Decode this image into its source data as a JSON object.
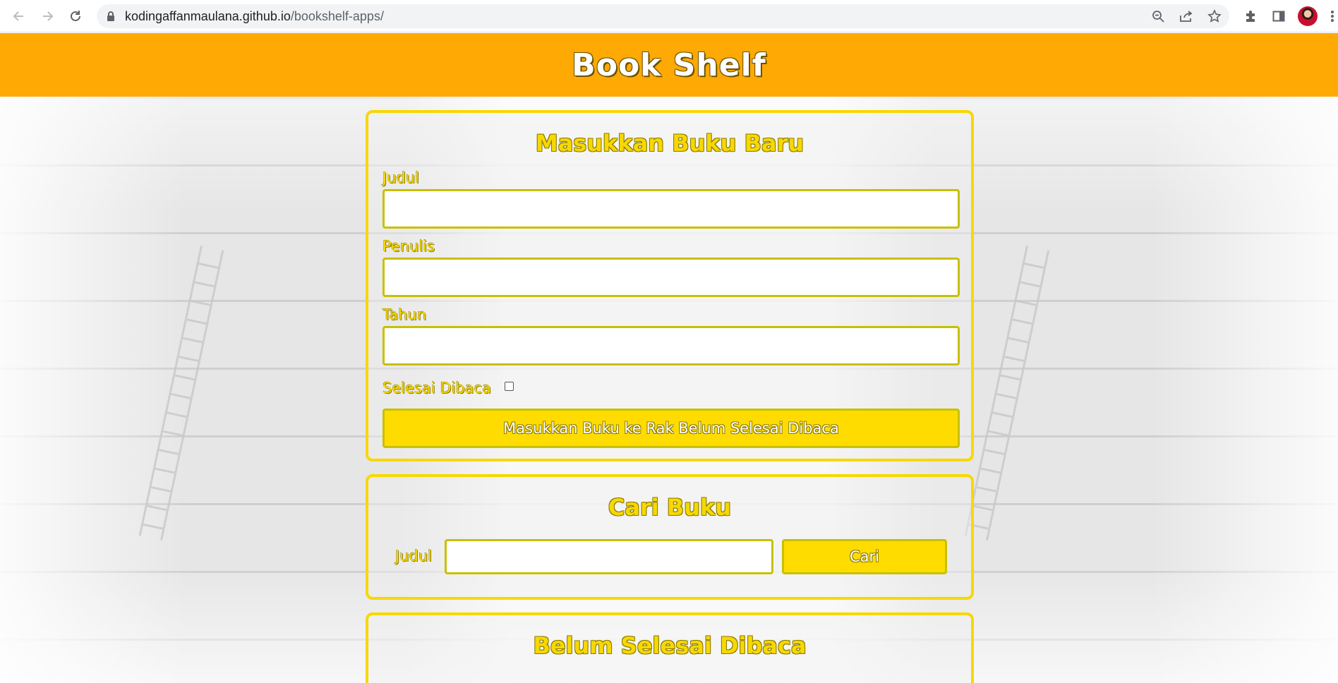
{
  "browser": {
    "url_host": "kodingaffanmaulana.github.io",
    "url_path": "/bookshelf-apps/",
    "icons": [
      "back-icon",
      "forward-icon",
      "reload-icon",
      "lock-icon",
      "zoom-icon",
      "share-icon",
      "bookmark-star-icon",
      "extensions-icon",
      "side-panel-icon",
      "avatar",
      "menu-icon"
    ]
  },
  "header": {
    "title": "Book Shelf"
  },
  "input_section": {
    "title": "Masukkan Buku Baru",
    "title_label": "Judul",
    "author_label": "Penulis",
    "year_label": "Tahun",
    "complete_label": "Selesai Dibaca",
    "submit_label": "Masukkan Buku ke Rak Belum Selesai Dibaca"
  },
  "search_section": {
    "title": "Cari Buku",
    "title_label": "Judul",
    "submit_label": "Cari"
  },
  "incomplete_section": {
    "title": "Belum Selesai Dibaca"
  },
  "colors": {
    "header": "#ffa904",
    "accent": "#f7d800",
    "button": "#ffdc00"
  }
}
